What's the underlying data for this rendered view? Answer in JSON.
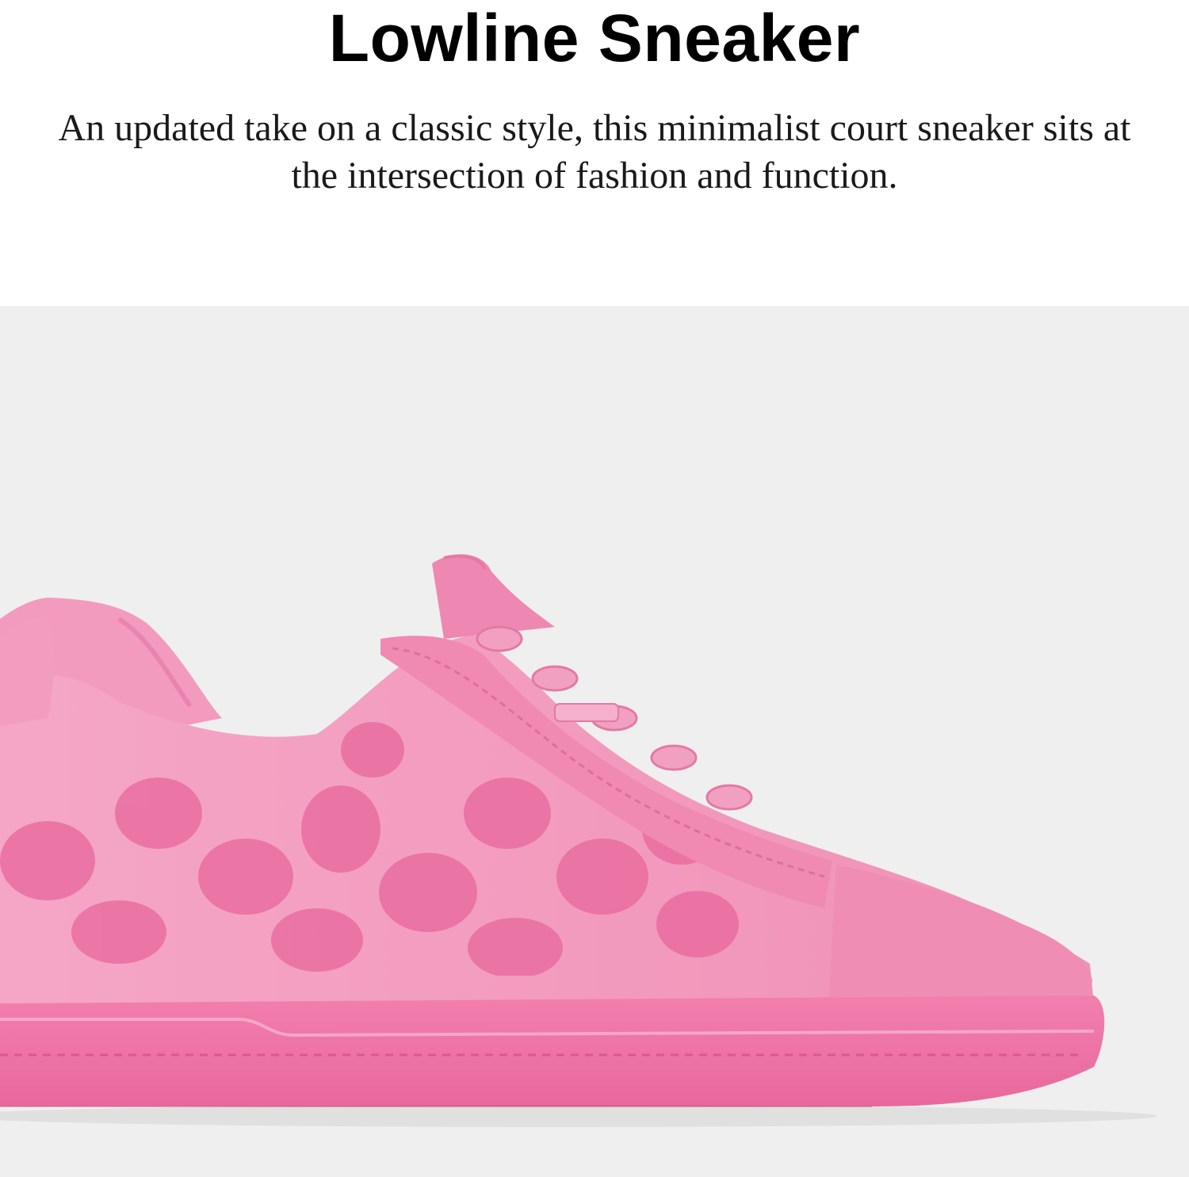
{
  "header": {
    "title": "Lowline Sneaker",
    "description": "An updated take on a classic style, this minimalist court sneaker sits at the intersection of fashion and function."
  },
  "product_image": {
    "subject": "pink-signature-canvas-sneaker",
    "background_color": "#efefef",
    "upper_color": "#f08cb4",
    "pattern_color": "#e8679b",
    "sole_color": "#ee79a8"
  }
}
